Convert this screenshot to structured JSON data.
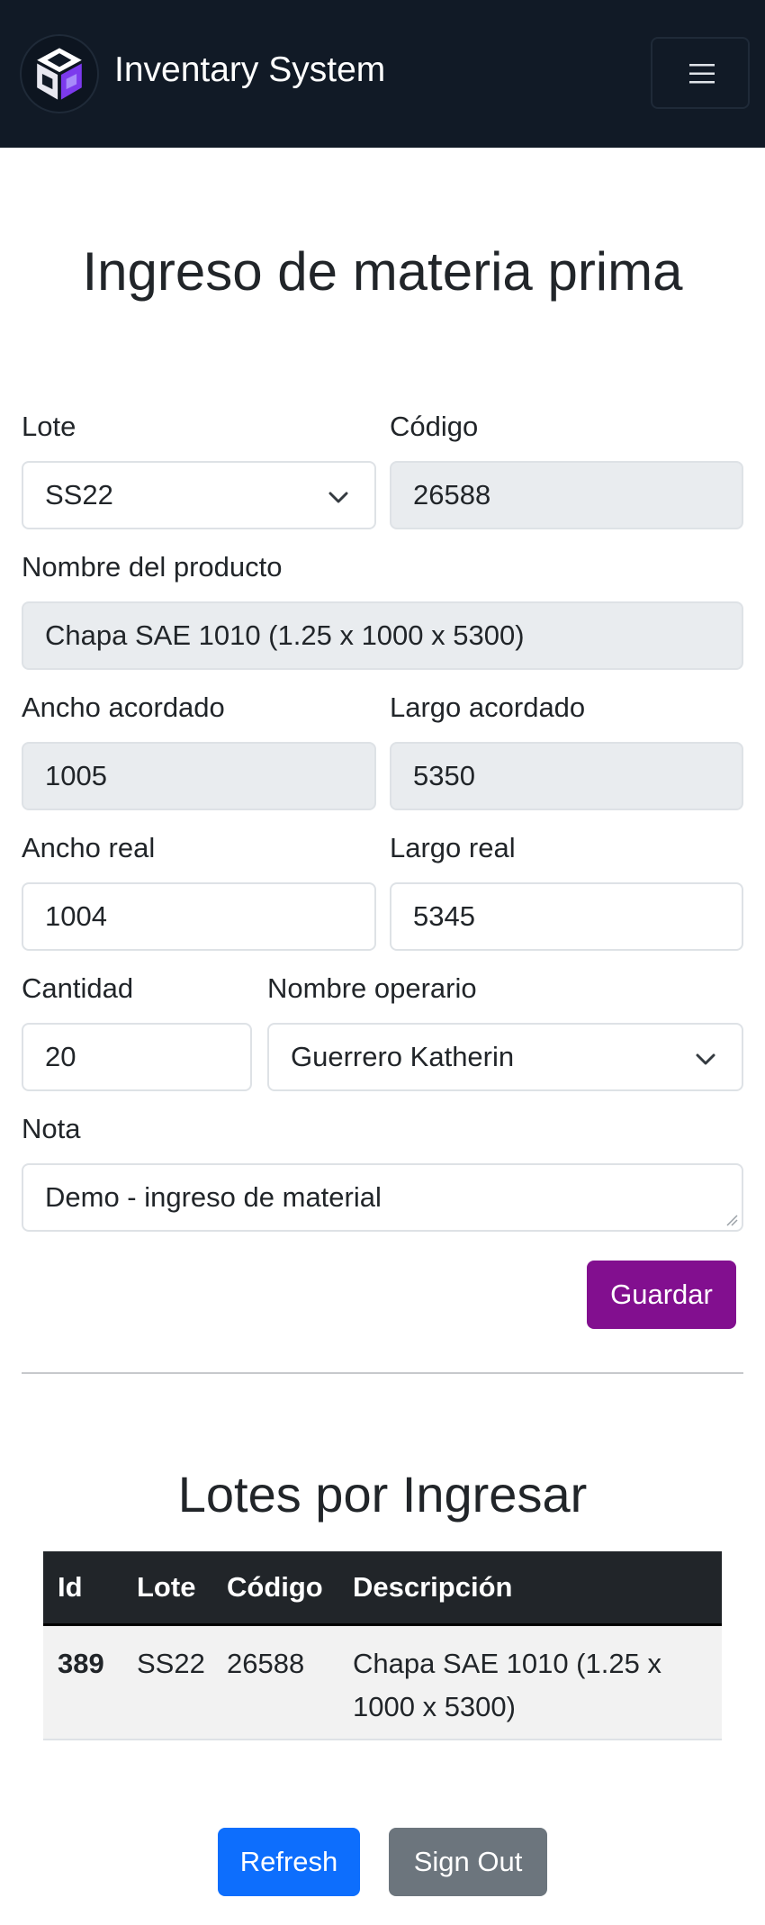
{
  "navbar": {
    "brand": "Inventary System",
    "logo_icon": "cube-logo-icon",
    "toggler_icon": "hamburger-menu-icon"
  },
  "page_title": "Ingreso de materia prima",
  "form": {
    "lote": {
      "label": "Lote",
      "value": "SS22"
    },
    "codigo": {
      "label": "Código",
      "value": "26588"
    },
    "nombre_producto": {
      "label": "Nombre del producto",
      "value": "Chapa SAE 1010 (1.25 x 1000 x 5300)"
    },
    "ancho_acordado": {
      "label": "Ancho acordado",
      "value": "1005"
    },
    "largo_acordado": {
      "label": "Largo acordado",
      "value": "5350"
    },
    "ancho_real": {
      "label": "Ancho real",
      "value": "1004"
    },
    "largo_real": {
      "label": "Largo real",
      "value": "5345"
    },
    "cantidad": {
      "label": "Cantidad",
      "value": "20"
    },
    "nombre_operario": {
      "label": "Nombre operario",
      "value": "Guerrero Katherin"
    },
    "nota": {
      "label": "Nota",
      "value": "Demo - ingreso de material"
    },
    "save_label": "Guardar"
  },
  "lotes": {
    "title": "Lotes por Ingresar",
    "columns": [
      "Id",
      "Lote",
      "Código",
      "Descripción"
    ],
    "rows": [
      {
        "id": "389",
        "lote": "SS22",
        "codigo": "26588",
        "descripcion_line1": "Chapa SAE 1010 (1.25 x",
        "descripcion_line2": "1000 x 5300)"
      }
    ]
  },
  "actions": {
    "refresh_label": "Refresh",
    "signout_label": "Sign Out"
  },
  "colors": {
    "navbar_bg": "#111a26",
    "save_button": "#820f8f",
    "refresh_button": "#0d6efd",
    "signout_button": "#6c757d"
  }
}
